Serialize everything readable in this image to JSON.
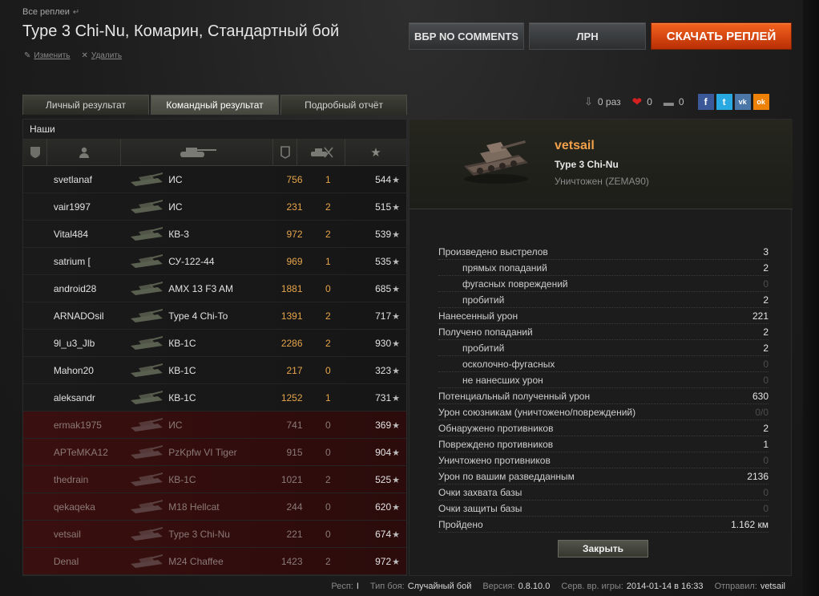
{
  "breadcrumb": {
    "label": "Все реплеи",
    "arrow": "↵"
  },
  "title": "Type 3 Chi-Nu, Комарин, Стандартный бой",
  "actions": {
    "edit": "Изменить",
    "delete": "Удалить"
  },
  "buttons": {
    "vbr": "ВБР NO COMMENTS",
    "lrn": "ЛРН",
    "download": "СКАЧАТЬ РЕПЛЕЙ"
  },
  "tabs": [
    "Личный результат",
    "Командный результат",
    "Подробный отчёт"
  ],
  "share": {
    "downloads": "0 раз",
    "likes": "0",
    "comments": "0",
    "fb": "f",
    "tw": "t",
    "vk": "vk",
    "ok": "ok"
  },
  "team": {
    "label": "Наши"
  },
  "icons": {
    "shield": "shield-icon",
    "player": "player-icon",
    "tank": "tank-icon",
    "xp": "xp-icon",
    "kills": "kills-icon",
    "star": "star-icon"
  },
  "players": [
    {
      "name": "svetlanaf",
      "tank": "ИС",
      "xp": "756",
      "kills": "1",
      "score": "544",
      "team": "ally"
    },
    {
      "name": "vair1997",
      "tank": "ИС",
      "xp": "231",
      "kills": "2",
      "score": "515",
      "team": "ally"
    },
    {
      "name": "Vital484",
      "tank": "КВ-3",
      "xp": "972",
      "kills": "2",
      "score": "539",
      "team": "ally"
    },
    {
      "name": "satrium [",
      "tank": "СУ-122-44",
      "xp": "969",
      "kills": "1",
      "score": "535",
      "team": "ally"
    },
    {
      "name": "android28",
      "tank": "AMX 13 F3 AM",
      "xp": "1881",
      "kills": "0",
      "score": "685",
      "team": "ally"
    },
    {
      "name": "ARNADOsil",
      "tank": "Type 4 Chi-To",
      "xp": "1391",
      "kills": "2",
      "score": "717",
      "team": "ally"
    },
    {
      "name": "9l_u3_Jlb",
      "tank": "КВ-1С",
      "xp": "2286",
      "kills": "2",
      "score": "930",
      "team": "ally"
    },
    {
      "name": "Mahon20",
      "tank": "КВ-1С",
      "xp": "217",
      "kills": "0",
      "score": "323",
      "team": "ally"
    },
    {
      "name": "aleksandr",
      "tank": "КВ-1С",
      "xp": "1252",
      "kills": "1",
      "score": "731",
      "team": "ally"
    },
    {
      "name": "ermak1975",
      "tank": "ИС",
      "xp": "741",
      "kills": "0",
      "score": "369",
      "team": "enemy"
    },
    {
      "name": "APTeMKA12",
      "tank": "PzKpfw VI Tiger",
      "xp": "915",
      "kills": "0",
      "score": "904",
      "team": "enemy"
    },
    {
      "name": "thedrain",
      "tank": "КВ-1С",
      "xp": "1021",
      "kills": "2",
      "score": "525",
      "team": "enemy"
    },
    {
      "name": "qekaqeka",
      "tank": "M18 Hellcat",
      "xp": "244",
      "kills": "0",
      "score": "620",
      "team": "enemy"
    },
    {
      "name": "vetsail",
      "tank": "Type 3 Chi-Nu",
      "xp": "221",
      "kills": "0",
      "score": "674",
      "team": "enemy"
    },
    {
      "name": "Denal",
      "tank": "M24 Chaffee",
      "xp": "1423",
      "kills": "2",
      "score": "972",
      "team": "enemy"
    }
  ],
  "detail": {
    "player": "vetsail",
    "tank": "Type 3 Chi-Nu",
    "destroyed": "Уничтожен (ZEMA90)",
    "stats": [
      {
        "label": "Произведено выстрелов",
        "value": "3",
        "sub": false,
        "zero": false
      },
      {
        "label": "прямых попаданий",
        "value": "2",
        "sub": true,
        "zero": false
      },
      {
        "label": "фугасных повреждений",
        "value": "0",
        "sub": true,
        "zero": true
      },
      {
        "label": "пробитий",
        "value": "2",
        "sub": true,
        "zero": false
      },
      {
        "label": "Нанесенный урон",
        "value": "221",
        "sub": false,
        "zero": false
      },
      {
        "label": "Получено попаданий",
        "value": "2",
        "sub": false,
        "zero": false
      },
      {
        "label": "пробитий",
        "value": "2",
        "sub": true,
        "zero": false
      },
      {
        "label": "осколочно-фугасных",
        "value": "0",
        "sub": true,
        "zero": true
      },
      {
        "label": "не нанесших урон",
        "value": "0",
        "sub": true,
        "zero": true
      },
      {
        "label": "Потенциальный полученный урон",
        "value": "630",
        "sub": false,
        "zero": false
      },
      {
        "label": "Урон союзникам (уничтожено/повреждений)",
        "value": "0/0",
        "sub": false,
        "zero": true
      },
      {
        "label": "Обнаружено противников",
        "value": "2",
        "sub": false,
        "zero": false
      },
      {
        "label": "Повреждено противников",
        "value": "1",
        "sub": false,
        "zero": false
      },
      {
        "label": "Уничтожено противников",
        "value": "0",
        "sub": false,
        "zero": true
      },
      {
        "label": "Урон по вашим разведданным",
        "value": "2136",
        "sub": false,
        "zero": false
      },
      {
        "label": "Очки захвата базы",
        "value": "0",
        "sub": false,
        "zero": true
      },
      {
        "label": "Очки защиты базы",
        "value": "0",
        "sub": false,
        "zero": true
      },
      {
        "label": "Пройдено",
        "value": "1.162 км",
        "sub": false,
        "zero": false
      }
    ],
    "close": "Закрыть"
  },
  "footer": {
    "resp_label": "Респ:",
    "resp": "I",
    "type_label": "Тип боя:",
    "type": "Случайный бой",
    "version_label": "Версия:",
    "version": "0.8.10.0",
    "time_label": "Серв. вр. игры:",
    "time": "2014-01-14 в 16:33",
    "sender_label": "Отправил:",
    "sender": "vetsail"
  },
  "colors": {
    "accent": "#f2a14a",
    "download_btn": "#e0491a",
    "enemy_row": "#3a0f0f"
  }
}
